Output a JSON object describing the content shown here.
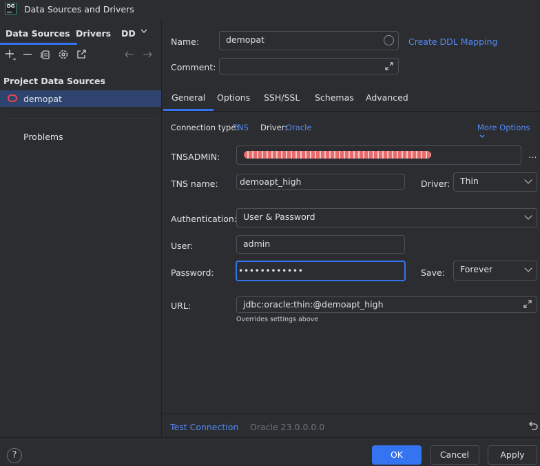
{
  "window": {
    "app_icon_text": "DG",
    "title": "Data Sources and Drivers"
  },
  "left": {
    "tabs": [
      "Data Sources",
      "Drivers",
      "DD"
    ],
    "toolbar_icons": [
      "add-icon",
      "remove-icon",
      "duplicate-icon",
      "settings-icon",
      "open-icon",
      "back-arrow-icon",
      "forward-arrow-icon"
    ],
    "section_title": "Project Data Sources",
    "data_sources": [
      {
        "label": "demopat",
        "icon": "oracle-icon",
        "color": "#e5484d"
      }
    ],
    "problems_label": "Problems"
  },
  "form": {
    "name_label": "Name:",
    "name_value": "demopat",
    "create_ddl_link": "Create DDL Mapping",
    "comment_label": "Comment:",
    "comment_value": "",
    "tabs": [
      "General",
      "Options",
      "SSH/SSL",
      "Schemas",
      "Advanced"
    ],
    "active_tab": "General",
    "connection_type_label": "Connection type:",
    "connection_type_value": "TNS",
    "driver_label": "Driver:",
    "driver_value": "Oracle",
    "more_options": "More Options",
    "tnsadmin_label": "TNSADMIN:",
    "tnsadmin_value": "",
    "tns_name_label": "TNS name:",
    "tns_name_value": "demoapt_high",
    "driver_select_label": "Driver:",
    "driver_select_value": "Thin",
    "auth_label": "Authentication:",
    "auth_value": "User & Password",
    "user_label": "User:",
    "user_value": "admin",
    "password_label": "Password:",
    "password_value": "••••••••••••",
    "save_label": "Save:",
    "save_value": "Forever",
    "url_label": "URL:",
    "url_value": "jdbc:oracle:thin:@demoapt_high",
    "url_hint": "Overrides settings above"
  },
  "status": {
    "test_connection": "Test Connection",
    "version": "Oracle 23.0.0.0.0"
  },
  "buttons": {
    "help": "?",
    "ok": "OK",
    "cancel": "Cancel",
    "apply": "Apply"
  },
  "colors": {
    "accent": "#3574f0",
    "link": "#548af7",
    "selection": "#2e436e",
    "background": "#2b2d30"
  }
}
